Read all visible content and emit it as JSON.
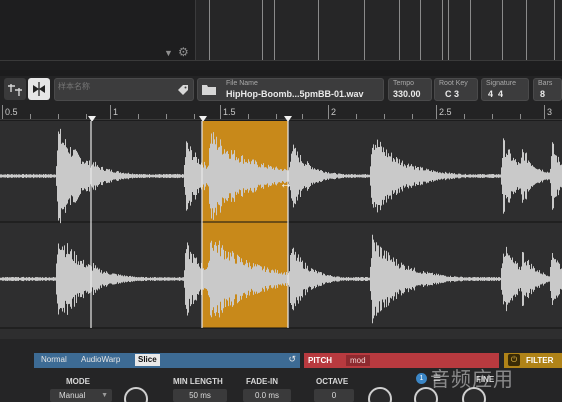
{
  "toolbar": {
    "name_placeholder": "样本名称",
    "file_name_label": "File Name",
    "file_name_value": "HipHop-Boomb...5pmBB-01.wav",
    "tempo_label": "Tempo",
    "tempo_value": "330.00",
    "root_key_label": "Root Key",
    "root_key_value": "C 3",
    "signature_label": "Signature",
    "signature_value": "4  4",
    "bars_label": "Bars",
    "bars_value": "8"
  },
  "ruler": {
    "labels": [
      "0.5",
      "1",
      "1.5",
      "2",
      "2.5",
      "3"
    ]
  },
  "bottom": {
    "modes": [
      "Normal",
      "AudioWarp",
      "Slice"
    ],
    "selected_mode": "Slice",
    "pitch_title": "PITCH",
    "pitch_mod": "mod",
    "filter_title": "FILTER",
    "mode_label": "MODE",
    "mode_value": "Manual",
    "min_length_label": "MIN LENGTH",
    "min_length_value": "50 ms",
    "fade_in_label": "FADE-IN",
    "fade_in_value": "0.0 ms",
    "octave_label": "OCTAVE",
    "octave_value": "0",
    "fine_label": "FINE",
    "info_badge": "1"
  },
  "watermark": "音频应用",
  "colors": {
    "selection": "#c8891a",
    "mode_bar": "#3d6b94",
    "pitch_bar": "#b83a3f",
    "filter_bar": "#b08318"
  }
}
